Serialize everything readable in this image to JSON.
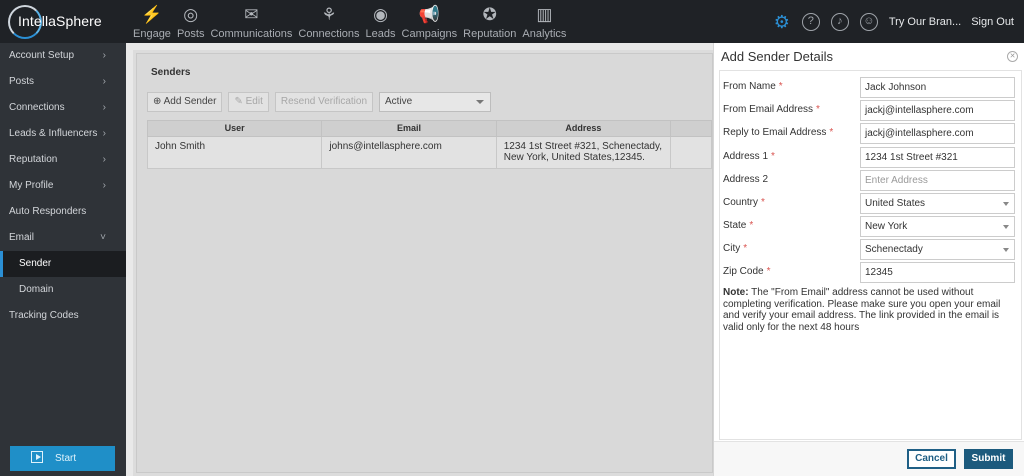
{
  "app": {
    "brand": "IntellaSphere"
  },
  "nav": [
    {
      "label": "Engage",
      "icon": "lightning-icon",
      "glyph": "⚡"
    },
    {
      "label": "Posts",
      "icon": "bubble-icon",
      "glyph": "◎"
    },
    {
      "label": "Communications",
      "icon": "mail-icon",
      "glyph": "✉"
    },
    {
      "label": "Connections",
      "icon": "network-icon",
      "glyph": "⚘"
    },
    {
      "label": "Leads",
      "icon": "target-icon",
      "glyph": "◉"
    },
    {
      "label": "Campaigns",
      "icon": "megaphone-icon",
      "glyph": "📢"
    },
    {
      "label": "Reputation",
      "icon": "badge-icon",
      "glyph": "✪"
    },
    {
      "label": "Analytics",
      "icon": "bar-chart-icon",
      "glyph": "▥"
    }
  ],
  "top_right": {
    "try_brand": "Try Our Bran...",
    "sign_out": "Sign Out",
    "help_glyph": "?",
    "bell_glyph": "♪",
    "chat_glyph": "☺",
    "gear_glyph": "⚙"
  },
  "sidebar": {
    "items": [
      {
        "label": "Account Setup",
        "arrow": "›"
      },
      {
        "label": "Posts",
        "arrow": "›"
      },
      {
        "label": "Connections",
        "arrow": "›"
      },
      {
        "label": "Leads & Influencers",
        "arrow": "›"
      },
      {
        "label": "Reputation",
        "arrow": "›"
      },
      {
        "label": "My Profile",
        "arrow": "›"
      },
      {
        "label": "Auto Responders",
        "arrow": ""
      },
      {
        "label": "Email",
        "arrow": "˅"
      },
      {
        "label": "Sender",
        "arrow": ""
      },
      {
        "label": "Domain",
        "arrow": ""
      },
      {
        "label": "Tracking Codes",
        "arrow": ""
      }
    ],
    "start_label": "Start"
  },
  "senders": {
    "title": "Senders",
    "add_label": "Add Sender",
    "edit_label": "Edit",
    "resend_label": "Resend Verification",
    "status_value": "Active",
    "columns": [
      "User",
      "Email",
      "Address",
      ""
    ],
    "rows": [
      {
        "user": "John Smith",
        "email": "johns@intellasphere.com",
        "address": "1234 1st Street #321, Schenectady, New York, United States,12345."
      }
    ]
  },
  "drawer": {
    "title": "Add Sender Details",
    "close_glyph": "✕",
    "fields": [
      {
        "label": "From Name",
        "required": "*",
        "value": "Jack Johnson",
        "placeholder": ""
      },
      {
        "label": "From Email Address",
        "required": "*",
        "value": "jackj@intellasphere.com",
        "placeholder": ""
      },
      {
        "label": "Reply to Email Address",
        "required": "*",
        "value": "jackj@intellasphere.com",
        "placeholder": ""
      },
      {
        "label": "Address 1",
        "required": "*",
        "value": "1234 1st Street #321",
        "placeholder": ""
      },
      {
        "label": "Address 2",
        "required": "",
        "value": "",
        "placeholder": "Enter Address"
      },
      {
        "label": "Country",
        "required": "*",
        "value": "United States",
        "placeholder": ""
      },
      {
        "label": "State",
        "required": "*",
        "value": "New York",
        "placeholder": ""
      },
      {
        "label": "City",
        "required": "*",
        "value": "Schenectady",
        "placeholder": ""
      },
      {
        "label": "Zip Code",
        "required": "*",
        "value": "12345",
        "placeholder": ""
      }
    ],
    "note_label": "Note:",
    "note_text": " The \"From Email\" address cannot be used without completing verification. Please make sure you open your email and verify your email address. The link provided in the email is valid only for the next 48 hours",
    "cancel_label": "Cancel",
    "submit_label": "Submit"
  }
}
